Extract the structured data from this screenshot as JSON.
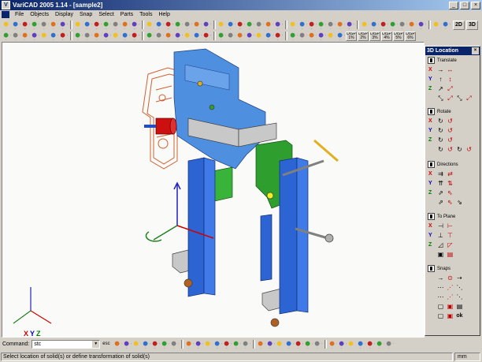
{
  "window": {
    "title": "VariCAD 2005 1.14 - [sample2]",
    "app_icon": "V"
  },
  "menu": [
    "File",
    "Objects",
    "Display",
    "Snap",
    "Select",
    "Parts",
    "Tools",
    "Help"
  ],
  "toolbar_text_buttons": [
    "DISP 1%",
    "DISP 2%",
    "DISP 3%",
    "DISP 4%",
    "DISP 5%",
    "DISP 6%"
  ],
  "toolbar_modes": [
    "2D",
    "3D"
  ],
  "panel": {
    "title": "3D Location",
    "sections": [
      "Translate",
      "Rotate",
      "Directions",
      "To Plane",
      "Snaps"
    ],
    "axes": [
      "X",
      "Y",
      "Z"
    ],
    "snap_label": "ok"
  },
  "viewport": {
    "triad_labels": [
      "X",
      "Y",
      "Z"
    ],
    "colors": {
      "plate": "#4f8fe0",
      "column": "#2c64d4",
      "green": "#2e9e2e",
      "wire": "#d06030",
      "gray": "#c8c8c8"
    }
  },
  "command": {
    "label": "Command:",
    "value": "stc",
    "esc": "esc"
  },
  "status": {
    "text": "Select location of solid(s) or define transformation of solid(s)",
    "unit": "mm"
  }
}
